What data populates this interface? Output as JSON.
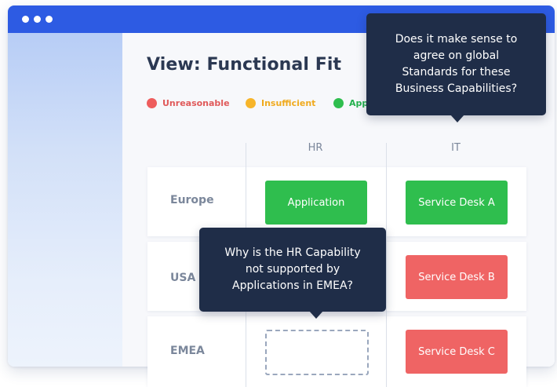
{
  "view": {
    "title": "View: Functional Fit"
  },
  "legend": [
    {
      "label": "Unreasonable",
      "color": "#ee5d5d"
    },
    {
      "label": "Insufficient",
      "color": "#f7b52a"
    },
    {
      "label": "App",
      "color": "#2fbe4e"
    }
  ],
  "columns": [
    "HR",
    "IT"
  ],
  "rows": [
    {
      "label": "Europe",
      "hr": "Application",
      "it": "Service Desk A"
    },
    {
      "label": "USA",
      "hr": "",
      "it": "Service Desk B"
    },
    {
      "label": "EMEA",
      "hr": "",
      "it": "Service Desk C"
    }
  ],
  "tooltips": {
    "top": {
      "lines": [
        "Does it make sense to",
        "agree on global",
        "Standards for these",
        "Business Capabilities?"
      ]
    },
    "middle": {
      "lines": [
        "Why is the HR Capability",
        "not supported by",
        "Applications in EMEA?"
      ]
    }
  },
  "colors": {
    "titlebar": "#2d5be3",
    "green": "#2fbe4e",
    "red": "#ef6464",
    "tooltip_bg": "#1f2d48"
  }
}
